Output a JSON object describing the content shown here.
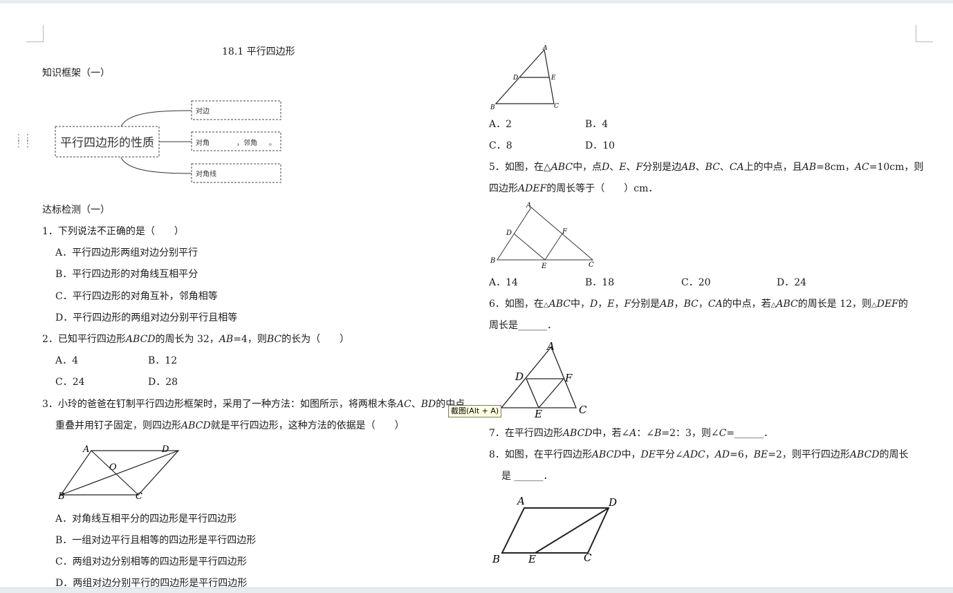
{
  "title": "18.1 平行四边形",
  "section1": "知识框架（一）",
  "mindmap": {
    "center": "平行四边形的性质",
    "b1": "对边",
    "b2a": "对角",
    "b2b": "，邻角",
    "b2c": "。",
    "b3": "对角线"
  },
  "section2": "达标检测（一）",
  "q1": {
    "stem": "1．下列说法不正确的是（　　）",
    "A": "A．平行四边形两组对边分别平行",
    "B": "B．平行四边形的对角线互相平分",
    "C": "C．平行四边形的对角互补，邻角相等",
    "D": "D．平行四边形的两组对边分别平行且相等"
  },
  "q2": {
    "p1": "2．已知平行四边形",
    "v1": "ABCD",
    "p2": "的周长为 32，",
    "v2": "AB",
    "p3": "=4，则",
    "v3": "BC",
    "p4": "的长为（　　）",
    "A": "A．4",
    "B": "B．12",
    "C": "C．24",
    "D": "D．28"
  },
  "q3": {
    "p1": "3．小玲的爸爸在钉制平行四边形框架时，采用了一种方法：如图所示，将两根木条",
    "v1": "AC",
    "p2": "、",
    "v2": "BD",
    "p3": "的中点",
    "p4": "重叠并用钉子固定，则四边形",
    "v3": "ABCD",
    "p5": "就是平行四边形，这种方法的依据是（　　）",
    "A": "A．对角线互相平分的四边形是平行四边形",
    "B": "B．一组对边平行且相等的四边形是平行四边形",
    "C": "C．两组对边分别相等的四边形是平行四边形",
    "D": "D．两组对边分别平行的四边形是平行四边形"
  },
  "q4": {
    "A": "A．2",
    "B": "B．4",
    "C": "C．8",
    "D": "D．10"
  },
  "q5": {
    "p1": "5．如图，在△",
    "v1": "ABC",
    "p2": "中，点",
    "v2": "D",
    "p3": "、",
    "v3": "E",
    "p4": "、",
    "v4": "F",
    "p5": "分别是边",
    "v5": "AB",
    "p6": "、",
    "v6": "BC",
    "p7": "、",
    "v7": "CA",
    "p8": "上的中点，且",
    "v8": "AB",
    "p9": "=8cm，",
    "v9": "AC",
    "p10": "=10cm，则",
    "p11": "四边形",
    "v10": "ADEF",
    "p12": "的周长等于（　　）cm．",
    "A": "A．14",
    "B": "B．18",
    "C": "C．20",
    "D": "D．24"
  },
  "q6": {
    "p1": "6．如图，在",
    "tri": "△",
    "v1": "ABC",
    "p2": "中，",
    "v2": "D",
    "c1": "，",
    "v3": "E",
    "c2": "，",
    "v4": "F",
    "p3": "分别是",
    "v5": "AB",
    "c3": "，",
    "v6": "BC",
    "c4": "，",
    "v7": "CA",
    "p4": "的中点，若",
    "v8": "ABC",
    "p5": "的周长是 12，则",
    "v9": "DEF",
    "p6": "的",
    "p7": "周长是______．"
  },
  "q7": {
    "p1": "7．在平行四边形",
    "v1": "ABCD",
    "p2": "中，若∠",
    "v2": "A",
    "p3": "：∠",
    "v3": "B",
    "p4": "=2：3，则∠",
    "v4": "C",
    "p5": "=______．"
  },
  "q8": {
    "p1": "8．如图，在平行四边形",
    "v1": "ABCD",
    "p2": "中，",
    "v2": "DE",
    "p3": "平分∠",
    "v3": "ADC",
    "p4": "，",
    "v4": "AD",
    "p5": "=6，",
    "v5": "BE",
    "p6": "=2，则平行四边形",
    "v6": "ABCD",
    "p7": "的周长",
    "p8": "是 ______．"
  },
  "fig3": {
    "A": "A",
    "B": "B",
    "C": "C",
    "D": "D",
    "O": "O"
  },
  "fig4": {
    "A": "A",
    "B": "B",
    "C": "C",
    "D": "D",
    "E": "E"
  },
  "fig5": {
    "A": "A",
    "B": "B",
    "C": "C",
    "D": "D",
    "E": "E",
    "F": "F"
  },
  "fig6": {
    "A": "A",
    "C": "C",
    "D": "D",
    "E": "E",
    "F": "F"
  },
  "fig8": {
    "A": "A",
    "B": "B",
    "C": "C",
    "D": "D",
    "E": "E"
  },
  "tooltip": "截图(Alt + A)"
}
